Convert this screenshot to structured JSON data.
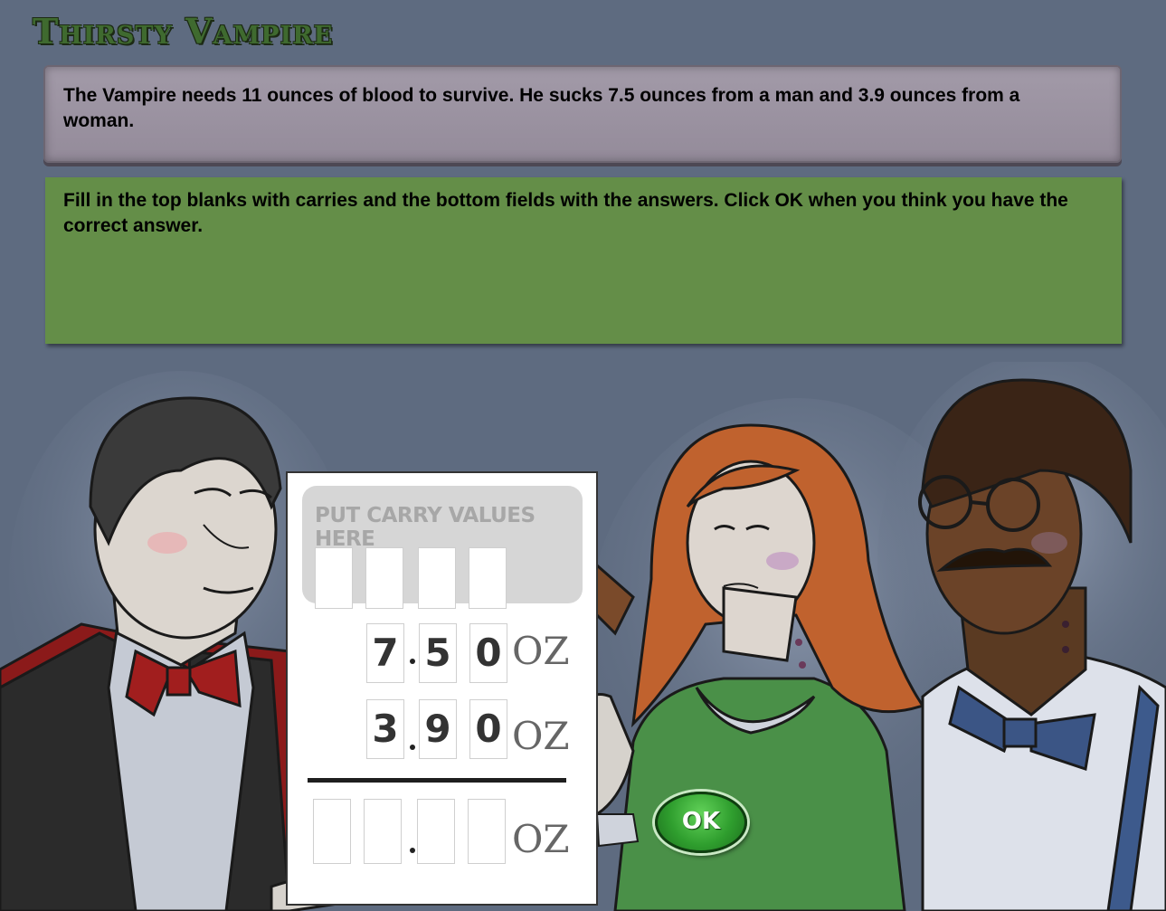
{
  "game_title": "Thirsty Vampire",
  "problem_text": "The Vampire needs 11 ounces of blood to survive. He sucks 7.5 ounces from a man and 3.9 ounces from a woman.",
  "instructions_text": "Fill in the top blanks with carries and the bottom fields with the answers. Click OK when you think you have the correct answer.",
  "worksheet": {
    "carry_label": "PUT CARRY VALUES HERE",
    "carry_values": [
      "",
      "",
      "",
      ""
    ],
    "addend1": {
      "ones": "7",
      "tenths": "5",
      "hundredths": "0",
      "unit": "OZ"
    },
    "addend2": {
      "ones": "3",
      "tenths": "9",
      "hundredths": "0",
      "unit": "OZ"
    },
    "answer": {
      "tens": "",
      "ones": "",
      "tenths": "",
      "hundredths": "",
      "unit": "OZ"
    }
  },
  "ok_label": "OK"
}
